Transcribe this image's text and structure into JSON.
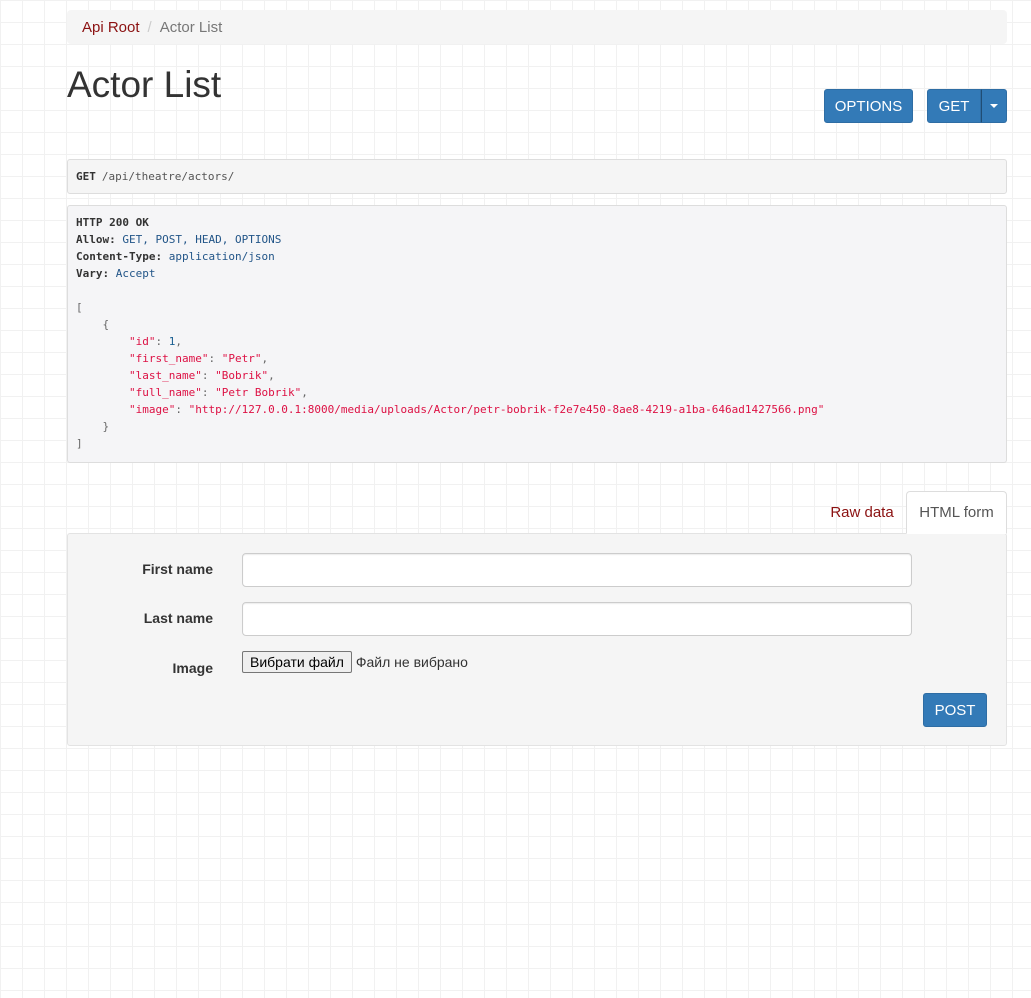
{
  "breadcrumb": {
    "root": "Api Root",
    "current": "Actor List"
  },
  "page": {
    "title": "Actor List"
  },
  "buttons": {
    "options": "OPTIONS",
    "get": "GET",
    "post": "POST"
  },
  "request": {
    "method": "GET",
    "path": "/api/theatre/actors/"
  },
  "response": {
    "status": "HTTP 200 OK",
    "headers": [
      {
        "key": "Allow",
        "value": "GET, POST, HEAD, OPTIONS"
      },
      {
        "key": "Content-Type",
        "value": "application/json"
      },
      {
        "key": "Vary",
        "value": "Accept"
      }
    ],
    "body": [
      {
        "id": 1,
        "first_name": "Petr",
        "last_name": "Bobrik",
        "full_name": "Petr Bobrik",
        "image": "http://127.0.0.1:8000/media/uploads/Actor/petr-bobrik-f2e7e450-8ae8-4219-a1ba-646ad1427566.png"
      }
    ]
  },
  "tabs": {
    "raw": "Raw data",
    "html": "HTML form"
  },
  "form": {
    "fields": [
      {
        "label": "First name",
        "value": "",
        "placeholder": ""
      },
      {
        "label": "Last name",
        "value": "",
        "placeholder": ""
      }
    ],
    "image": {
      "label": "Image",
      "button": "Вибрати файл",
      "status": "Файл не вибрано"
    }
  },
  "colors": {
    "primary": "#337ab7",
    "link": "#8b1111",
    "json_string": "#dd1144",
    "json_number": "#195f91",
    "header_value": "#225588"
  }
}
